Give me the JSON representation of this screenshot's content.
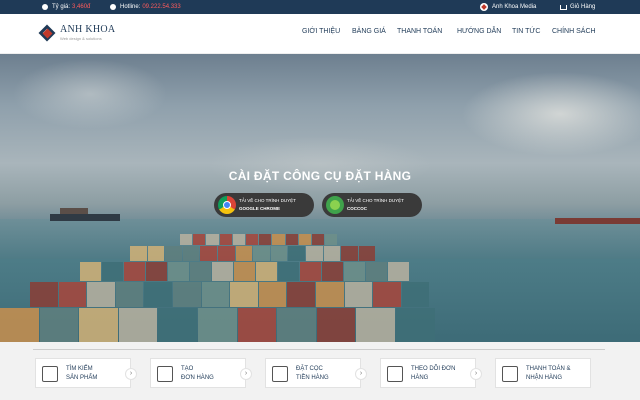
{
  "topbar": {
    "rate_label": "Tỷ giá:",
    "rate_value": "3,460đ",
    "hotline_label": "Hotline:",
    "hotline_value": "09.222.54.333",
    "media": "Anh Khoa Media",
    "cart": "Giỏ Hàng"
  },
  "brand": {
    "name": "ANH KHOA",
    "sub": "Web design & solutions"
  },
  "nav": [
    "GIỚI THIỆU",
    "BẢNG GIÁ",
    "THANH TOÁN",
    "HƯỚNG DẪN",
    "TIN TỨC",
    "CHÍNH SÁCH"
  ],
  "hero": {
    "title": "CÀI ĐẶT CÔNG CỤ ĐẶT HÀNG",
    "buttons": [
      {
        "line1": "TẢI VỀ CHO TRÌNH DUYỆT",
        "line2": "GOOGLE CHROME",
        "icon": "chrome-icon"
      },
      {
        "line1": "TẢI VỀ CHO TRÌNH DUYỆT",
        "line2": "COCCOC",
        "icon": "coccoc-icon"
      }
    ]
  },
  "steps": [
    {
      "line1": "TÌM KIẾM",
      "line2": "SẢN PHẨM",
      "icon": "monitor-icon"
    },
    {
      "line1": "TẠO",
      "line2": "ĐƠN HÀNG",
      "icon": "document-icon"
    },
    {
      "line1": "ĐẶT CỌC",
      "line2": "TIỀN HÀNG",
      "icon": "money-icon"
    },
    {
      "line1": "THEO DÕI ĐƠN",
      "line2": "HÀNG",
      "icon": "laptop-icon"
    },
    {
      "line1": "THANH TOÁN &",
      "line2": "NHẬN HÀNG",
      "icon": "truck-icon"
    }
  ],
  "colors": {
    "navy": "#1f3a57",
    "accent": "#c0392b",
    "hotline": "#ff5b5b"
  }
}
